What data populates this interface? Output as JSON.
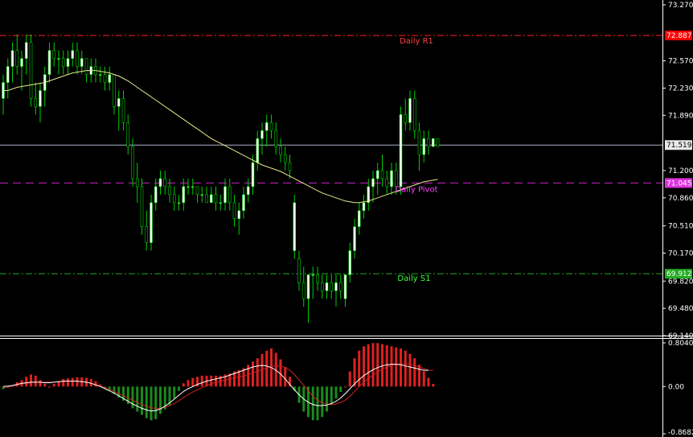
{
  "chart_data": [
    {
      "type": "candlestick",
      "name": "price",
      "ylim": [
        69.14,
        73.33
      ],
      "y_ticks": [
        "73.270",
        "72.570",
        "72.230",
        "71.890",
        "71.200",
        "70.860",
        "70.510",
        "70.170",
        "69.820",
        "69.480",
        "69.140"
      ],
      "colors": {
        "bull": "#ffffff",
        "bear": "#000000",
        "wick": "#00cc00",
        "ma": "#e8e88a",
        "bg": "#000000"
      },
      "current_price": {
        "label": "71.519",
        "value": 71.519,
        "line_color": "#aab0c8",
        "tag_bg": "#e8e8e8",
        "tag_fg": "#000000"
      },
      "levels": [
        {
          "label": "Daily R1",
          "value": 72.887,
          "tag": "72.887",
          "color": "#ff2020",
          "style": "dashdot",
          "label_color": "#ff4040",
          "tag_bg": "#ff0000",
          "tag_fg": "#ffffff"
        },
        {
          "label": "Daily Pivot",
          "value": 71.045,
          "tag": "71.045",
          "color": "#cc22cc",
          "style": "dash",
          "label_color": "#ff40ff",
          "tag_bg": "#dd33dd",
          "tag_fg": "#ffffff"
        },
        {
          "label": "Daily S1",
          "value": 69.912,
          "tag": "69.912",
          "color": "#22aa22",
          "style": "dashdot",
          "label_color": "#40ff40",
          "tag_bg": "#22aa22",
          "tag_fg": "#ffffff"
        }
      ],
      "ohlc": [
        [
          72.1,
          72.4,
          71.9,
          72.3
        ],
        [
          72.3,
          72.6,
          72.1,
          72.5
        ],
        [
          72.5,
          72.8,
          72.3,
          72.7
        ],
        [
          72.7,
          72.9,
          72.4,
          72.5
        ],
        [
          72.5,
          72.7,
          72.2,
          72.6
        ],
        [
          72.6,
          72.9,
          72.4,
          72.8
        ],
        [
          72.8,
          72.9,
          72.0,
          72.1
        ],
        [
          72.1,
          72.3,
          71.9,
          72.0
        ],
        [
          72.0,
          72.3,
          71.8,
          72.2
        ],
        [
          72.2,
          72.5,
          72.0,
          72.4
        ],
        [
          72.4,
          72.8,
          72.3,
          72.7
        ],
        [
          72.7,
          72.8,
          72.5,
          72.6
        ],
        [
          72.6,
          72.7,
          72.4,
          72.6
        ],
        [
          72.6,
          72.7,
          72.4,
          72.5
        ],
        [
          72.5,
          72.7,
          72.4,
          72.6
        ],
        [
          72.6,
          72.8,
          72.5,
          72.7
        ],
        [
          72.7,
          72.8,
          72.4,
          72.5
        ],
        [
          72.5,
          72.7,
          72.4,
          72.6
        ],
        [
          72.6,
          72.6,
          72.3,
          72.4
        ],
        [
          72.4,
          72.6,
          72.3,
          72.5
        ],
        [
          72.5,
          72.6,
          72.3,
          72.4
        ],
        [
          72.4,
          72.5,
          72.3,
          72.4
        ],
        [
          72.4,
          72.5,
          72.2,
          72.3
        ],
        [
          72.3,
          72.5,
          72.2,
          72.4
        ],
        [
          72.4,
          72.4,
          71.9,
          72.0
        ],
        [
          72.0,
          72.2,
          71.7,
          72.1
        ],
        [
          72.1,
          72.2,
          71.7,
          71.8
        ],
        [
          71.8,
          71.9,
          71.4,
          71.5
        ],
        [
          71.5,
          71.6,
          71.0,
          71.1
        ],
        [
          71.1,
          71.3,
          70.8,
          71.0
        ],
        [
          71.0,
          71.1,
          70.4,
          70.5
        ],
        [
          70.5,
          70.7,
          70.2,
          70.3
        ],
        [
          70.3,
          70.9,
          70.2,
          70.8
        ],
        [
          70.8,
          71.1,
          70.7,
          71.0
        ],
        [
          71.0,
          71.2,
          70.9,
          71.1
        ],
        [
          71.1,
          71.2,
          70.9,
          71.0
        ],
        [
          71.0,
          71.1,
          70.8,
          70.9
        ],
        [
          70.9,
          71.0,
          70.7,
          70.8
        ],
        [
          70.8,
          70.9,
          70.7,
          70.8
        ],
        [
          70.8,
          71.1,
          70.7,
          71.0
        ],
        [
          71.0,
          71.1,
          70.9,
          71.0
        ],
        [
          71.0,
          71.1,
          70.9,
          71.0
        ],
        [
          71.0,
          71.0,
          70.8,
          70.9
        ],
        [
          70.9,
          71.0,
          70.8,
          70.9
        ],
        [
          70.9,
          71.0,
          70.8,
          70.8
        ],
        [
          70.8,
          71.0,
          70.8,
          70.9
        ],
        [
          70.9,
          71.0,
          70.7,
          70.8
        ],
        [
          70.8,
          70.9,
          70.7,
          70.8
        ],
        [
          70.8,
          71.1,
          70.7,
          71.0
        ],
        [
          71.0,
          71.1,
          70.7,
          70.8
        ],
        [
          70.8,
          70.9,
          70.5,
          70.6
        ],
        [
          70.6,
          70.8,
          70.4,
          70.7
        ],
        [
          70.7,
          71.0,
          70.6,
          70.9
        ],
        [
          70.9,
          71.1,
          70.8,
          71.0
        ],
        [
          71.0,
          71.4,
          70.9,
          71.3
        ],
        [
          71.3,
          71.7,
          71.2,
          71.6
        ],
        [
          71.6,
          71.8,
          71.4,
          71.7
        ],
        [
          71.7,
          71.9,
          71.5,
          71.8
        ],
        [
          71.8,
          71.9,
          71.6,
          71.7
        ],
        [
          71.7,
          71.8,
          71.4,
          71.5
        ],
        [
          71.5,
          71.6,
          71.3,
          71.4
        ],
        [
          71.4,
          71.5,
          71.2,
          71.3
        ],
        [
          71.3,
          71.4,
          71.1,
          71.2
        ],
        [
          70.2,
          70.9,
          70.1,
          70.8
        ],
        [
          70.1,
          70.2,
          69.7,
          69.8
        ],
        [
          69.8,
          70.0,
          69.5,
          69.6
        ],
        [
          69.6,
          69.9,
          69.3,
          69.9
        ],
        [
          69.9,
          70.0,
          69.6,
          69.9
        ],
        [
          69.9,
          70.0,
          69.7,
          69.8
        ],
        [
          69.8,
          69.9,
          69.6,
          69.7
        ],
        [
          69.7,
          69.9,
          69.6,
          69.8
        ],
        [
          69.8,
          69.9,
          69.6,
          69.7
        ],
        [
          69.7,
          69.9,
          69.5,
          69.8
        ],
        [
          69.8,
          69.9,
          69.6,
          69.7
        ],
        [
          69.6,
          69.7,
          69.5,
          69.9
        ],
        [
          69.9,
          70.3,
          69.8,
          70.2
        ],
        [
          70.2,
          70.6,
          70.1,
          70.5
        ],
        [
          70.5,
          70.8,
          70.4,
          70.7
        ],
        [
          70.7,
          70.9,
          70.6,
          70.8
        ],
        [
          70.8,
          71.1,
          70.7,
          71.0
        ],
        [
          71.0,
          71.2,
          70.8,
          71.1
        ],
        [
          71.1,
          71.3,
          70.9,
          71.2
        ],
        [
          71.2,
          71.4,
          71.0,
          71.1
        ],
        [
          71.1,
          71.2,
          70.9,
          71.0
        ],
        [
          71.0,
          71.3,
          70.9,
          71.2
        ],
        [
          71.2,
          71.3,
          70.9,
          71.0
        ],
        [
          71.0,
          72.0,
          70.9,
          71.9
        ],
        [
          71.9,
          72.1,
          71.7,
          71.8
        ],
        [
          71.8,
          72.2,
          71.7,
          72.1
        ],
        [
          72.1,
          72.2,
          71.6,
          71.7
        ],
        [
          71.7,
          71.8,
          71.2,
          71.4
        ],
        [
          71.4,
          71.7,
          71.3,
          71.6
        ],
        [
          71.6,
          71.7,
          71.4,
          71.5
        ],
        [
          71.5,
          71.6,
          71.5,
          71.6
        ],
        [
          71.6,
          71.6,
          71.5,
          71.5
        ]
      ],
      "ma": [
        72.2,
        72.2,
        72.22,
        72.24,
        72.25,
        72.26,
        72.27,
        72.28,
        72.29,
        72.3,
        72.32,
        72.34,
        72.36,
        72.38,
        72.4,
        72.42,
        72.43,
        72.44,
        72.45,
        72.45,
        72.45,
        72.44,
        72.43,
        72.42,
        72.4,
        72.38,
        72.35,
        72.32,
        72.28,
        72.24,
        72.2,
        72.16,
        72.12,
        72.08,
        72.04,
        72.0,
        71.96,
        71.92,
        71.88,
        71.84,
        71.8,
        71.76,
        71.72,
        71.68,
        71.64,
        71.6,
        71.57,
        71.54,
        71.51,
        71.48,
        71.45,
        71.42,
        71.39,
        71.36,
        71.33,
        71.3,
        71.27,
        71.25,
        71.23,
        71.21,
        71.19,
        71.16,
        71.13,
        71.1,
        71.07,
        71.04,
        71.01,
        70.98,
        70.95,
        70.92,
        70.9,
        70.88,
        70.86,
        70.84,
        70.82,
        70.81,
        70.8,
        70.8,
        70.81,
        70.82,
        70.84,
        70.86,
        70.88,
        70.9,
        70.92,
        70.94,
        70.96,
        70.98,
        71.0,
        71.02,
        71.04,
        71.06,
        71.07,
        71.08,
        71.09
      ]
    },
    {
      "type": "histogram",
      "name": "oscillator",
      "ylim": [
        -0.8682,
        0.80408
      ],
      "y_ticks": [
        "0.80408",
        "0.00",
        "-0.8682"
      ],
      "colors": {
        "up": "#e02020",
        "down": "#1a8a1a",
        "signal": "#cc2222",
        "main": "#ffffff"
      },
      "histogram": [
        -0.05,
        -0.02,
        0.02,
        0.08,
        0.12,
        0.18,
        0.22,
        0.2,
        0.12,
        0.05,
        0.0,
        0.05,
        0.1,
        0.14,
        0.15,
        0.16,
        0.17,
        0.17,
        0.16,
        0.14,
        0.1,
        0.04,
        -0.02,
        -0.08,
        -0.14,
        -0.2,
        -0.26,
        -0.32,
        -0.4,
        -0.46,
        -0.52,
        -0.58,
        -0.62,
        -0.6,
        -0.5,
        -0.42,
        -0.34,
        -0.22,
        -0.08,
        0.06,
        0.12,
        0.16,
        0.18,
        0.2,
        0.2,
        0.2,
        0.2,
        0.2,
        0.22,
        0.24,
        0.28,
        0.3,
        0.34,
        0.4,
        0.46,
        0.52,
        0.6,
        0.66,
        0.7,
        0.62,
        0.5,
        0.36,
        0.18,
        -0.08,
        -0.3,
        -0.46,
        -0.56,
        -0.62,
        -0.62,
        -0.56,
        -0.46,
        -0.34,
        -0.22,
        -0.1,
        0.0,
        0.28,
        0.52,
        0.66,
        0.74,
        0.78,
        0.8,
        0.8,
        0.78,
        0.76,
        0.74,
        0.72,
        0.7,
        0.66,
        0.6,
        0.52,
        0.4,
        0.28,
        0.16,
        0.05
      ],
      "signal": [
        -0.02,
        -0.01,
        0.01,
        0.03,
        0.05,
        0.06,
        0.07,
        0.08,
        0.08,
        0.08,
        0.08,
        0.08,
        0.09,
        0.09,
        0.1,
        0.1,
        0.1,
        0.09,
        0.08,
        0.06,
        0.04,
        0.01,
        -0.02,
        -0.05,
        -0.09,
        -0.13,
        -0.17,
        -0.21,
        -0.25,
        -0.29,
        -0.33,
        -0.36,
        -0.39,
        -0.4,
        -0.4,
        -0.38,
        -0.35,
        -0.31,
        -0.26,
        -0.2,
        -0.15,
        -0.1,
        -0.06,
        -0.02,
        0.02,
        0.05,
        0.08,
        0.1,
        0.12,
        0.14,
        0.16,
        0.18,
        0.2,
        0.22,
        0.25,
        0.28,
        0.31,
        0.34,
        0.37,
        0.38,
        0.38,
        0.35,
        0.3,
        0.22,
        0.12,
        0.02,
        -0.08,
        -0.18,
        -0.25,
        -0.3,
        -0.32,
        -0.33,
        -0.32,
        -0.29,
        -0.25,
        -0.18,
        -0.09,
        0.0,
        0.08,
        0.15,
        0.21,
        0.27,
        0.32,
        0.36,
        0.39,
        0.41,
        0.42,
        0.42,
        0.41,
        0.39,
        0.36,
        0.33,
        0.3,
        0.3
      ],
      "main": [
        0.0,
        0.01,
        0.02,
        0.04,
        0.06,
        0.07,
        0.08,
        0.08,
        0.08,
        0.07,
        0.07,
        0.08,
        0.09,
        0.1,
        0.1,
        0.1,
        0.1,
        0.09,
        0.08,
        0.06,
        0.03,
        0.0,
        -0.04,
        -0.08,
        -0.12,
        -0.17,
        -0.22,
        -0.27,
        -0.32,
        -0.36,
        -0.4,
        -0.43,
        -0.45,
        -0.44,
        -0.41,
        -0.36,
        -0.3,
        -0.23,
        -0.16,
        -0.09,
        -0.04,
        0.0,
        0.04,
        0.07,
        0.1,
        0.12,
        0.14,
        0.16,
        0.18,
        0.21,
        0.24,
        0.27,
        0.3,
        0.33,
        0.36,
        0.38,
        0.39,
        0.38,
        0.35,
        0.3,
        0.23,
        0.14,
        0.04,
        -0.06,
        -0.15,
        -0.23,
        -0.29,
        -0.33,
        -0.35,
        -0.35,
        -0.34,
        -0.31,
        -0.27,
        -0.21,
        -0.13,
        -0.04,
        0.05,
        0.13,
        0.2,
        0.26,
        0.31,
        0.35,
        0.38,
        0.4,
        0.41,
        0.41,
        0.4,
        0.38,
        0.36,
        0.34,
        0.32,
        0.3,
        0.3
      ]
    }
  ]
}
